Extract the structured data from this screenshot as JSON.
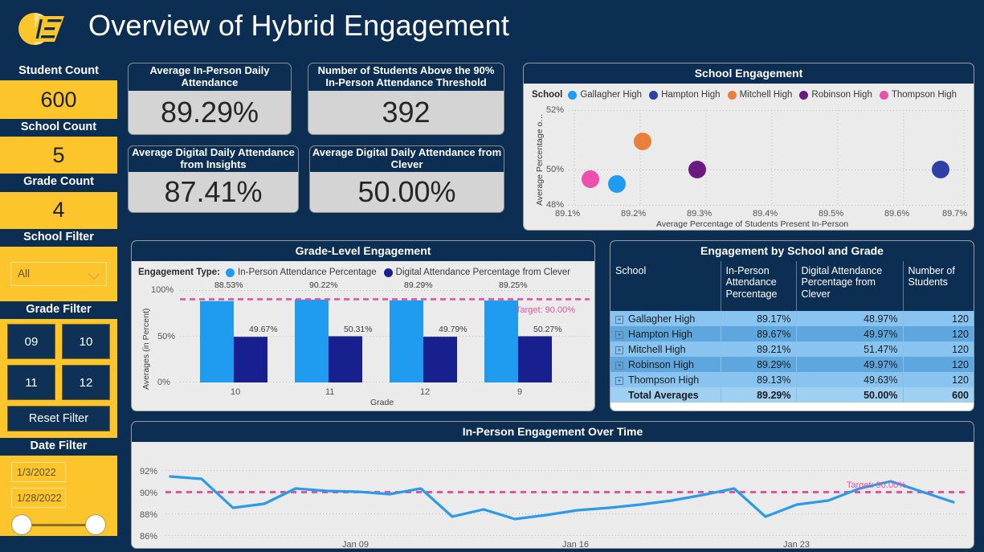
{
  "header": {
    "title": "Overview of Hybrid Engagement",
    "logo_name": "iea-logo"
  },
  "sidebar": {
    "student_count_label": "Student Count",
    "student_count_value": "600",
    "school_count_label": "School Count",
    "school_count_value": "5",
    "grade_count_label": "Grade Count",
    "grade_count_value": "4",
    "school_filter_label": "School Filter",
    "school_filter_value": "All",
    "grade_filter_label": "Grade Filter",
    "grade_buttons": [
      "09",
      "10",
      "11",
      "12"
    ],
    "reset_label": "Reset Filter",
    "date_filter_label": "Date Filter",
    "date_start": "1/3/2022",
    "date_end": "1/28/2022"
  },
  "kpis": [
    {
      "title": "Average In-Person Daily Attendance",
      "value": "89.29%"
    },
    {
      "title": "Number of Students Above the 90% In-Person Attendance Threshold",
      "value": "392"
    },
    {
      "title": "Average Digital Daily Attendance from Insights",
      "value": "87.41%"
    },
    {
      "title": "Average Digital Daily Attendance from Clever",
      "value": "50.00%"
    }
  ],
  "colors": {
    "navy": "#0b2e52",
    "gold": "#fcc52b",
    "panel_bg": "#ebebeb",
    "azure": "#1f9cf0",
    "dark_blue": "#18208f",
    "orange": "#e8803c",
    "purple": "#6b1b7f",
    "pink": "#ec4fae",
    "target_pink": "#e0559f",
    "line_blue": "#2b9ae8"
  },
  "chart_data": [
    {
      "id": "school-engagement",
      "type": "scatter",
      "title": "School Engagement",
      "legend_title": "School",
      "legend_position": "top",
      "xlabel": "Average Percentage of Students Present In-Person",
      "ylabel": "Average Percentage o…",
      "xticks": [
        "89.1%",
        "89.2%",
        "89.3%",
        "89.4%",
        "89.5%",
        "89.6%",
        "89.7%"
      ],
      "yticks": [
        "48%",
        "50%",
        "52%"
      ],
      "xlim": [
        89.05,
        89.73
      ],
      "ylim": [
        48,
        52.35
      ],
      "grid": true,
      "points": [
        {
          "name": "Gallagher High",
          "x": 89.17,
          "y": 48.97,
          "color": "#1f9cf0"
        },
        {
          "name": "Hampton High",
          "x": 89.67,
          "y": 49.97,
          "color": "#2f3fa8"
        },
        {
          "name": "Mitchell High",
          "x": 89.21,
          "y": 51.47,
          "color": "#e8803c"
        },
        {
          "name": "Robinson High",
          "x": 89.29,
          "y": 49.97,
          "color": "#6b1b7f"
        },
        {
          "name": "Thompson High",
          "x": 89.13,
          "y": 49.63,
          "color": "#ec4fae"
        }
      ]
    },
    {
      "id": "grade-level-engagement",
      "type": "bar",
      "title": "Grade-Level Engagement",
      "legend_title": "Engagement Type:",
      "legend_position": "top",
      "xlabel": "Grade",
      "ylabel": "Averages (in Percent)",
      "categories": [
        "10",
        "11",
        "12",
        "9"
      ],
      "yticks": [
        "0%",
        "50%",
        "100%"
      ],
      "ylim": [
        0,
        100
      ],
      "grid": true,
      "target_value": 90.0,
      "target_label": "Target: 90.00%",
      "series": [
        {
          "name": "In-Person Attendance Percentage",
          "color": "#1f9cf0",
          "values": [
            88.53,
            90.22,
            89.29,
            89.25
          ],
          "labels": [
            "88.53%",
            "90.22%",
            "89.29%",
            "89.25%"
          ]
        },
        {
          "name": "Digital Attendance Percentage from Clever",
          "color": "#18208f",
          "values": [
            49.67,
            50.31,
            49.79,
            50.27
          ],
          "labels": [
            "49.67%",
            "50.31%",
            "49.79%",
            "50.27%"
          ]
        }
      ]
    },
    {
      "id": "in-person-engagement-over-time",
      "type": "line",
      "title": "In-Person Engagement Over Time",
      "xlabel": "",
      "ylabel": "",
      "yticks": [
        "86%",
        "88%",
        "90%",
        "92%"
      ],
      "ylim": [
        85.2,
        92.8
      ],
      "xticks": [
        "Jan 09",
        "Jan 16",
        "Jan 23"
      ],
      "grid": true,
      "target_value": 90.0,
      "target_label": "Target: 90.00%",
      "series": [
        {
          "name": "In-Person Attendance Percentage",
          "color": "#2b9ae8",
          "x": [
            "Jan 03",
            "Jan 04",
            "Jan 05",
            "Jan 06",
            "Jan 07",
            "Jan 08",
            "Jan 09",
            "Jan 10",
            "Jan 11",
            "Jan 12",
            "Jan 13",
            "Jan 14",
            "Jan 15",
            "Jan 16",
            "Jan 17",
            "Jan 18",
            "Jan 19",
            "Jan 20",
            "Jan 21",
            "Jan 22",
            "Jan 23",
            "Jan 24",
            "Jan 25",
            "Jan 26",
            "Jan 27",
            "Jan 28"
          ],
          "values": [
            91.45,
            91.25,
            88.55,
            88.95,
            90.35,
            90.15,
            90.05,
            89.8,
            90.35,
            87.75,
            88.45,
            87.55,
            87.95,
            88.35,
            88.6,
            88.85,
            89.25,
            89.75,
            90.35,
            87.75,
            88.85,
            89.25,
            90.35,
            91.05,
            90.05,
            89.1
          ]
        }
      ]
    }
  ],
  "matrix": {
    "title": "Engagement by School and Grade",
    "columns": [
      "School",
      "In-Person Attendance Percentage",
      "Digital Attendance Percentage from Clever",
      "Number of Students"
    ],
    "rows": [
      {
        "school": "Gallagher High",
        "in_person": "89.17%",
        "digital": "48.97%",
        "students": "120"
      },
      {
        "school": "Hampton High",
        "in_person": "89.67%",
        "digital": "49.97%",
        "students": "120"
      },
      {
        "school": "Mitchell High",
        "in_person": "89.21%",
        "digital": "51.47%",
        "students": "120"
      },
      {
        "school": "Robinson High",
        "in_person": "89.29%",
        "digital": "49.97%",
        "students": "120"
      },
      {
        "school": "Thompson High",
        "in_person": "89.13%",
        "digital": "49.63%",
        "students": "120"
      }
    ],
    "total": {
      "school": "Total Averages",
      "in_person": "89.29%",
      "digital": "50.00%",
      "students": "600"
    }
  }
}
